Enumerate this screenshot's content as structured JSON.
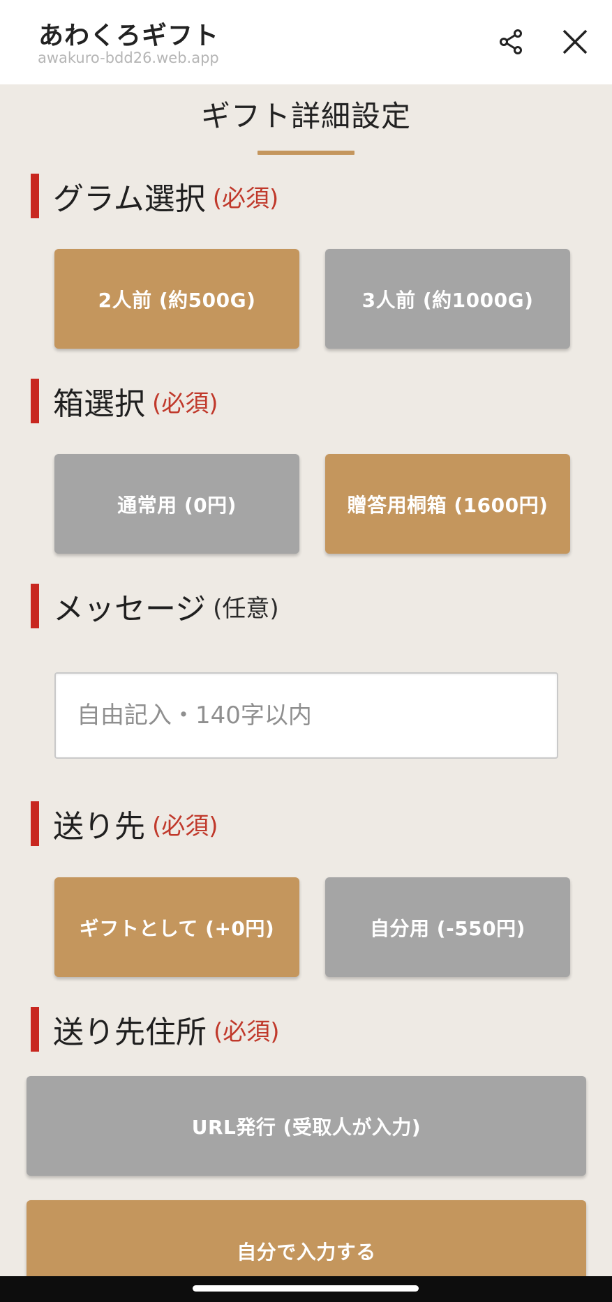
{
  "header": {
    "app_title": "あわくろギフト",
    "app_url": "awakuro-bdd26.web.app",
    "share_icon": "share-icon",
    "close_icon": "close-icon"
  },
  "page": {
    "heading": "ギフト詳細設定"
  },
  "colors": {
    "selected": "#c4965d",
    "unselected": "#a5a5a5",
    "accent_bar": "#c8271f",
    "required_text": "#c0392b",
    "background": "#eeeae4"
  },
  "sections": {
    "gram": {
      "label": "グラム選択",
      "tag": "(必須)",
      "options": [
        "2人前 (約500G)",
        "3人前 (約1000G)"
      ],
      "selected": "2人前 (約500G)"
    },
    "box": {
      "label": "箱選択",
      "tag": "(必須)",
      "options": [
        "通常用 (0円)",
        "贈答用桐箱 (1600円)"
      ],
      "selected": "贈答用桐箱 (1600円)"
    },
    "message": {
      "label": "メッセージ",
      "tag": "(任意)",
      "placeholder": "自由記入・140字以内",
      "value": ""
    },
    "destination": {
      "label": "送り先",
      "tag": "(必須)",
      "options": [
        "ギフトとして (+0円)",
        "自分用 (-550円)"
      ],
      "selected": "ギフトとして (+0円)"
    },
    "address": {
      "label": "送り先住所",
      "tag": "(必須)",
      "options": [
        "URL発行 (受取人が入力)",
        "自分で入力する"
      ],
      "selected": "自分で入力する"
    }
  }
}
